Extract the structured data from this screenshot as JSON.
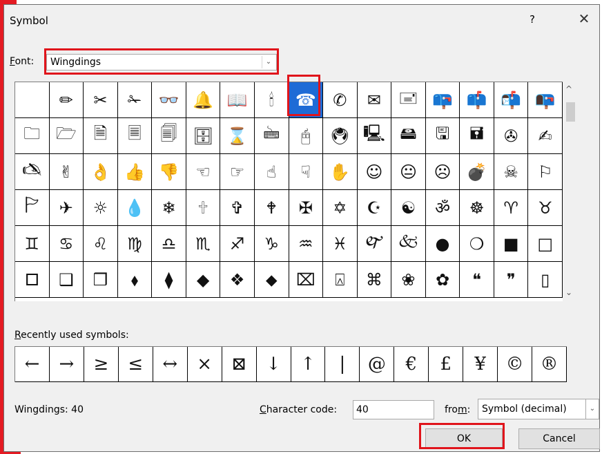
{
  "dialog": {
    "title": "Symbol",
    "help_label": "?",
    "close_label": "✕"
  },
  "font": {
    "label_accel": "F",
    "label_rest": "ont:",
    "value": "Wingdings",
    "arrow": "⌄"
  },
  "symbol_grid": [
    [
      " ",
      "✏",
      "✂",
      "✁",
      "👓",
      "🔔",
      "📖",
      "🕯",
      "☎",
      "✆",
      "✉",
      "🖃",
      "📪",
      "📫",
      "📬",
      "📭"
    ],
    [
      "🗀",
      "🗁",
      "🗎",
      "🗏",
      "🗐",
      "🗄",
      "⌛",
      "🖮",
      "🖰",
      "🖲",
      "🖳",
      "🖴",
      "🖫",
      "🖬",
      "✇",
      "✍"
    ],
    [
      "🖎",
      "✌",
      "👌",
      "👍",
      "👎",
      "☜",
      "☞",
      "☝",
      "☟",
      "✋",
      "☺",
      "😐",
      "☹",
      "💣",
      "☠",
      "⚐"
    ],
    [
      "🏱",
      "✈",
      "☼",
      "💧",
      "❄",
      "🕆",
      "✞",
      "🕈",
      "✠",
      "✡",
      "☪",
      "☯",
      "ॐ",
      "☸",
      "♈",
      "♉"
    ],
    [
      "♊",
      "♋",
      "♌",
      "♍",
      "♎",
      "♏",
      "♐",
      "♑",
      "♒",
      "♓",
      "🙰",
      "🙵",
      "●",
      "❍",
      "■",
      "□"
    ],
    [
      "🞐",
      "❑",
      "❒",
      "⬧",
      "⧫",
      "◆",
      "❖",
      "⬥",
      "⌧",
      "⍓",
      "⌘",
      "❀",
      "✿",
      "❝",
      "❞",
      "▯"
    ]
  ],
  "scrollbar": {
    "up_arrow": "^",
    "down_arrow": "⌄"
  },
  "recent": {
    "label_accel": "R",
    "label_rest": "ecently used symbols:",
    "symbols": [
      "←",
      "→",
      "≥",
      "≤",
      "↔",
      "×",
      "⊠",
      "↓",
      "↑",
      "|",
      "@",
      "€",
      "£",
      "¥",
      "©",
      "®"
    ]
  },
  "status_text": "Wingdings: 40",
  "char_code": {
    "label_accel": "C",
    "label_rest": "haracter code:",
    "value": "40"
  },
  "from": {
    "label_pre": "fro",
    "label_accel": "m",
    "label_post": ":",
    "value": "Symbol (decimal)",
    "arrow": "⌄"
  },
  "buttons": {
    "ok": "OK",
    "cancel": "Cancel"
  },
  "colors": {
    "highlight": "#e0141b",
    "selection": "#1e6bd6"
  }
}
